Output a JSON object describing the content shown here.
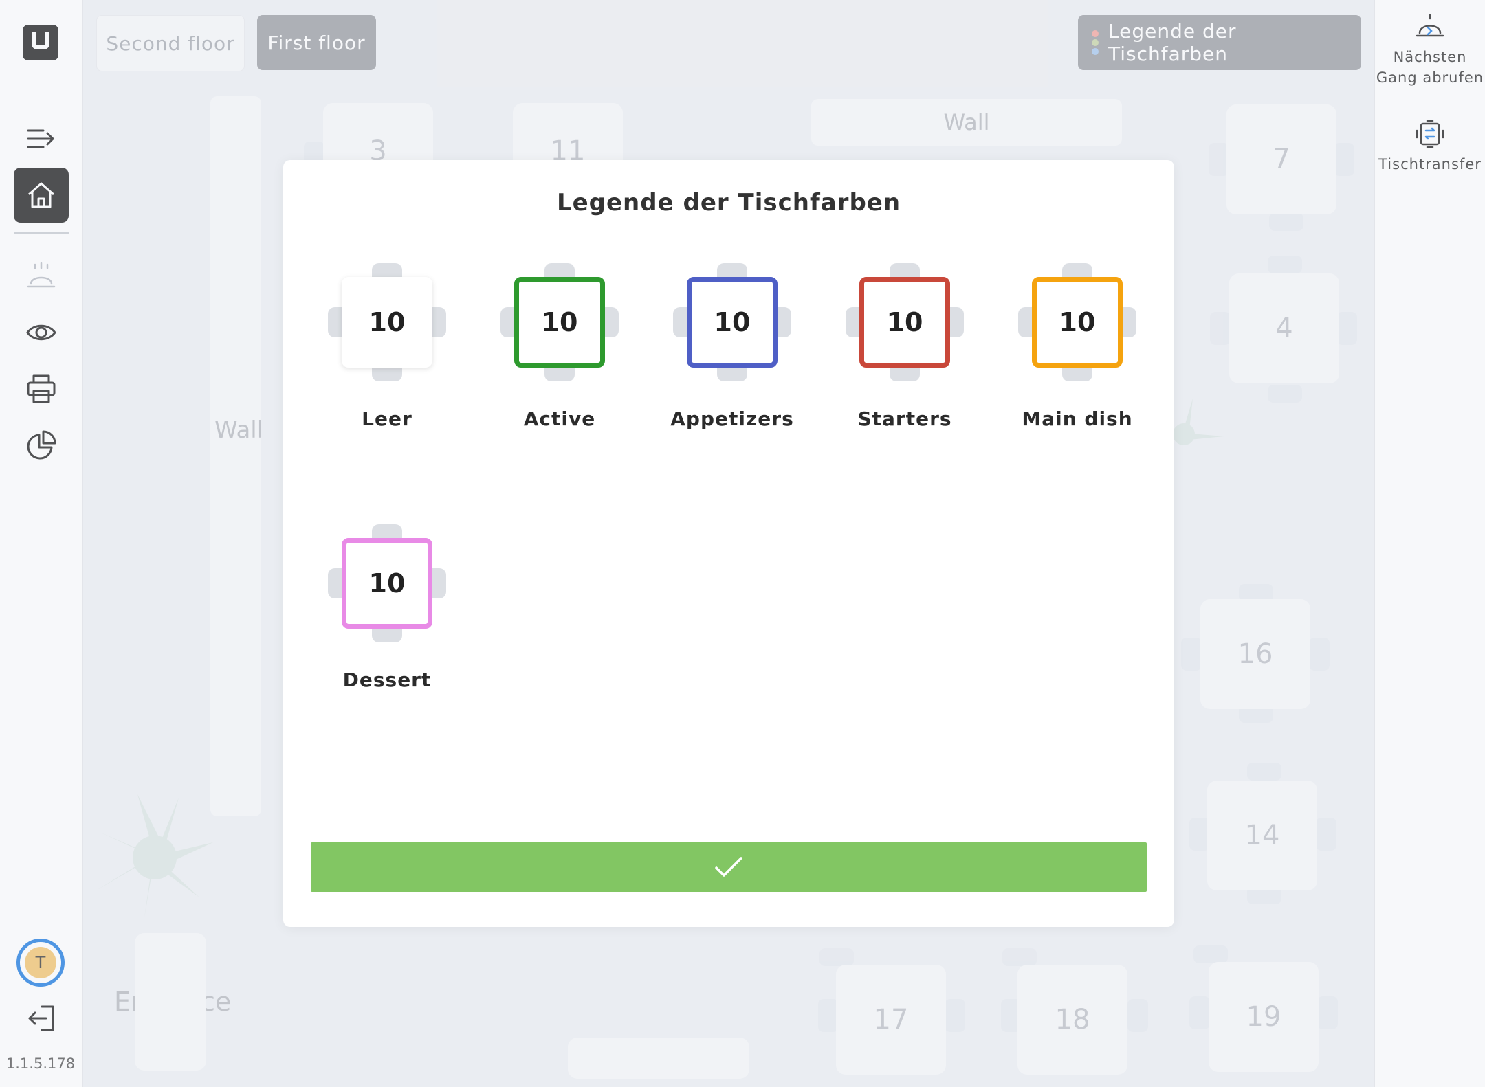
{
  "sidebar": {
    "version": "1.1.5.178",
    "avatar_initial": "T",
    "items": [
      {
        "icon": "menu-expand-icon"
      },
      {
        "icon": "home-icon",
        "active": true
      },
      {
        "icon": "cloche-icon"
      },
      {
        "icon": "eye-icon"
      },
      {
        "icon": "printer-icon"
      },
      {
        "icon": "pie-chart-icon"
      },
      {
        "icon": "logout-icon"
      }
    ]
  },
  "topbar": {
    "floors": [
      "Second floor",
      "First floor"
    ],
    "selected_floor": "First floor",
    "legend_button": "Legende der Tischfarben",
    "legend_dot_colors": [
      "#f4a7a0",
      "#c8d6a8",
      "#a8c9ee"
    ]
  },
  "right_panel": {
    "next_course": "Nächsten Gang abrufen",
    "table_transfer": "Tischtransfer"
  },
  "floor_plan": {
    "labels": {
      "wall_left": "Wall",
      "wall_top": "Wall",
      "entrance": "Entrance"
    },
    "tables": [
      "3",
      "11",
      "7",
      "4",
      "16",
      "14",
      "17",
      "18",
      "19"
    ]
  },
  "modal": {
    "title": "Legende der Tischfarben",
    "items": [
      {
        "label": "Leer",
        "number": "10",
        "color": "#ffffff"
      },
      {
        "label": "Active",
        "number": "10",
        "color": "#2e9a2e"
      },
      {
        "label": "Appetizers",
        "number": "10",
        "color": "#4f5fc6"
      },
      {
        "label": "Starters",
        "number": "10",
        "color": "#c9483a"
      },
      {
        "label": "Main dish",
        "number": "10",
        "color": "#f5a30f"
      },
      {
        "label": "Dessert",
        "number": "10",
        "color": "#e88ae6"
      }
    ],
    "confirm_icon": "checkmark-icon",
    "confirm_color": "#82c663"
  }
}
